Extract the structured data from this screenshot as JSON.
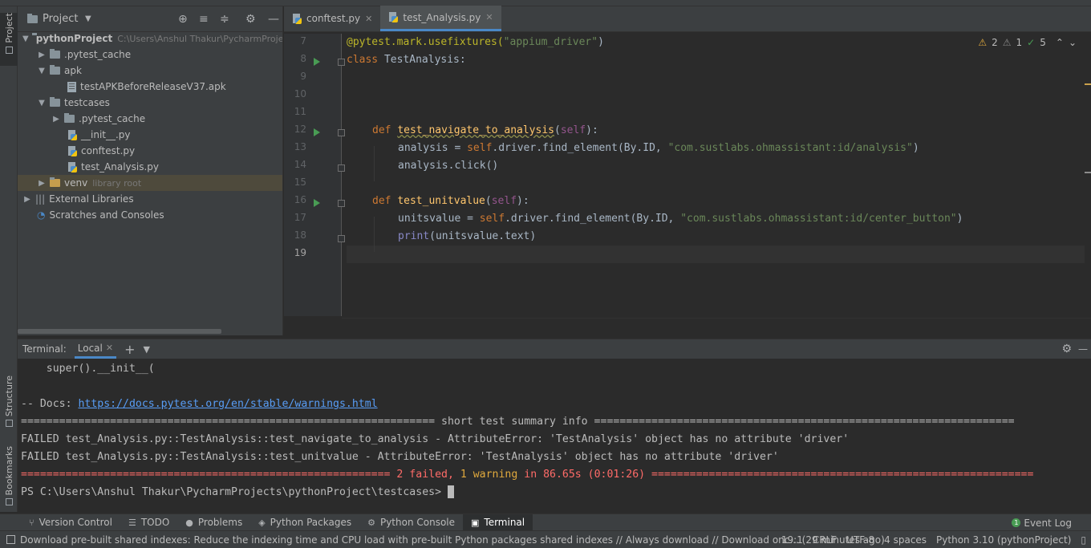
{
  "project_panel": {
    "title": "Project",
    "tree": [
      {
        "label": "pythonProject",
        "hint": "C:\\Users\\Anshul Thakur\\PycharmProje"
      },
      {
        "label": ".pytest_cache"
      },
      {
        "label": "apk"
      },
      {
        "label": "testAPKBeforeReleaseV37.apk"
      },
      {
        "label": "testcases"
      },
      {
        "label": ".pytest_cache"
      },
      {
        "label": "__init__.py"
      },
      {
        "label": "conftest.py"
      },
      {
        "label": "test_Analysis.py"
      },
      {
        "label": "venv",
        "hint": "library root"
      },
      {
        "label": "External Libraries"
      },
      {
        "label": "Scratches and Consoles"
      }
    ]
  },
  "left_strip": {
    "project": "Project",
    "structure": "Structure",
    "bookmarks": "Bookmarks"
  },
  "editor": {
    "tabs": [
      {
        "label": "conftest.py"
      },
      {
        "label": "test_Analysis.py"
      }
    ],
    "inspections": {
      "warnings": "2",
      "weak": "1",
      "ok": "5"
    },
    "line_numbers": [
      "7",
      "8",
      "9",
      "10",
      "11",
      "12",
      "13",
      "14",
      "15",
      "16",
      "17",
      "18",
      "19"
    ],
    "code": {
      "l7_deco": "@pytest.mark.usefixtures(",
      "l7_str": "\"appium_driver\"",
      "l7_end": ")",
      "l8_kw": "class ",
      "l8_name": "TestAnalysis:",
      "l12_kw": "def ",
      "l12_fn": "test_navigate_to_analysis",
      "l12_p1": "(",
      "l12_self": "self",
      "l12_p2": "):",
      "l13_a": "analysis = ",
      "l13_self": "self",
      "l13_b": ".driver.find_element(By.ID, ",
      "l13_str": "\"com.sustlabs.ohmassistant:id/analysis\"",
      "l13_c": ")",
      "l14": "analysis.click()",
      "l16_kw": "def ",
      "l16_fn": "test_unitvalue",
      "l16_p1": "(",
      "l16_self": "self",
      "l16_p2": "):",
      "l17_a": "unitsvalue = ",
      "l17_self": "self",
      "l17_b": ".driver.find_element(By.ID, ",
      "l17_str": "\"com.sustlabs.ohmassistant:id/center_button\"",
      "l17_c": ")",
      "l18_fn": "print",
      "l18_rest": "(unitsvalue.text)"
    }
  },
  "terminal": {
    "label": "Terminal:",
    "tab": "Local",
    "lines": {
      "l1": "    super().__init__(",
      "l2": "",
      "l3_a": "-- Docs: ",
      "l3_link": "https://docs.pytest.org/en/stable/warnings.html",
      "l4": "================================================================= short test summary info ==================================================================",
      "l5": "FAILED test_Analysis.py::TestAnalysis::test_navigate_to_analysis - AttributeError: 'TestAnalysis' object has no attribute 'driver'",
      "l6": "FAILED test_Analysis.py::TestAnalysis::test_unitvalue - AttributeError: 'TestAnalysis' object has no attribute 'driver'",
      "l7_a": "========================================================== 2 failed, ",
      "l7_yel": "1 warning",
      "l7_b": " in 86.65s (0:01:26) ============================================================",
      "l8": "PS C:\\Users\\Anshul Thakur\\PycharmProjects\\pythonProject\\testcases> "
    }
  },
  "bottom_tools": [
    {
      "label": "Version Control"
    },
    {
      "label": "TODO"
    },
    {
      "label": "Problems"
    },
    {
      "label": "Python Packages"
    },
    {
      "label": "Python Console"
    },
    {
      "label": "Terminal"
    }
  ],
  "event_log": {
    "label": "Event Log",
    "count": "1"
  },
  "statusbar": {
    "message": "Download pre-built shared indexes: Reduce the indexing time and CPU load with pre-built Python packages shared indexes // Always download // Download onc... (29 minutes ago)",
    "position": "19:1",
    "line_sep": "CRLF",
    "encoding": "UTF-8",
    "indent": "4 spaces",
    "interpreter": "Python 3.10 (pythonProject)"
  }
}
